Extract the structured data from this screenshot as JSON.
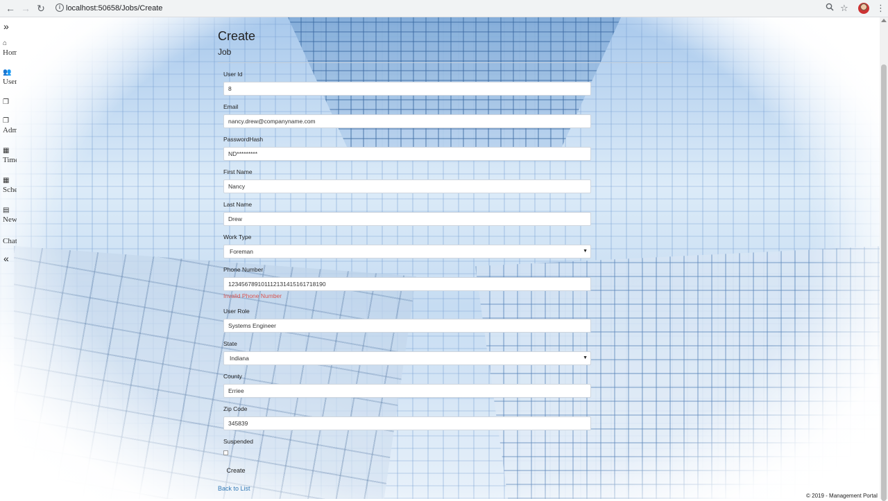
{
  "browser": {
    "url": "localhost:50658/Jobs/Create",
    "back_icon": "arrow-left-icon",
    "forward_icon": "arrow-right-icon",
    "reload_icon": "reload-icon",
    "info_icon": "info-icon",
    "zoom_icon": "magnifier-icon",
    "star_icon": "star-icon",
    "menu_icon": "kebab-menu-icon"
  },
  "sidebar": {
    "expand_icon": "double-chevron-right-icon",
    "collapse_icon": "double-chevron-left-icon",
    "items": [
      {
        "icon": "home-icon",
        "label": "Hom"
      },
      {
        "icon": "users-icon",
        "label": "User"
      },
      {
        "icon": "copy-icon",
        "label": ""
      },
      {
        "icon": "copy-icon",
        "label": "Adm"
      },
      {
        "icon": "calendar-icon",
        "label": "Time"
      },
      {
        "icon": "calendar-icon",
        "label": "Sche"
      },
      {
        "icon": "newspaper-icon",
        "label": "New"
      },
      {
        "icon": "",
        "label": "Chat"
      }
    ]
  },
  "page": {
    "title": "Create",
    "subtitle": "Job"
  },
  "form": {
    "user_id": {
      "label": "User Id",
      "value": "8"
    },
    "email": {
      "label": "Email",
      "value": "nancy.drew@companyname.com"
    },
    "password_hash": {
      "label": "PasswordHash",
      "value": "ND*********"
    },
    "first_name": {
      "label": "First Name",
      "value": "Nancy"
    },
    "last_name": {
      "label": "Last Name",
      "value": "Drew"
    },
    "work_type": {
      "label": "Work Type",
      "value": "Foreman"
    },
    "phone_number": {
      "label": "Phone Number",
      "value": "123456789101112131415161718190",
      "error": "Invalid Phone Number"
    },
    "user_role": {
      "label": "User Role",
      "value": "Systems Engineer"
    },
    "state": {
      "label": "State",
      "value": "Indiana"
    },
    "county": {
      "label": "County",
      "value": "Erriee"
    },
    "zip_code": {
      "label": "Zip Code",
      "value": "345839"
    },
    "suspended": {
      "label": "Suspended",
      "checked": false
    },
    "create_label": "Create",
    "back_label": "Back to List"
  },
  "footer": {
    "text": "© 2019 - Management Portal"
  }
}
